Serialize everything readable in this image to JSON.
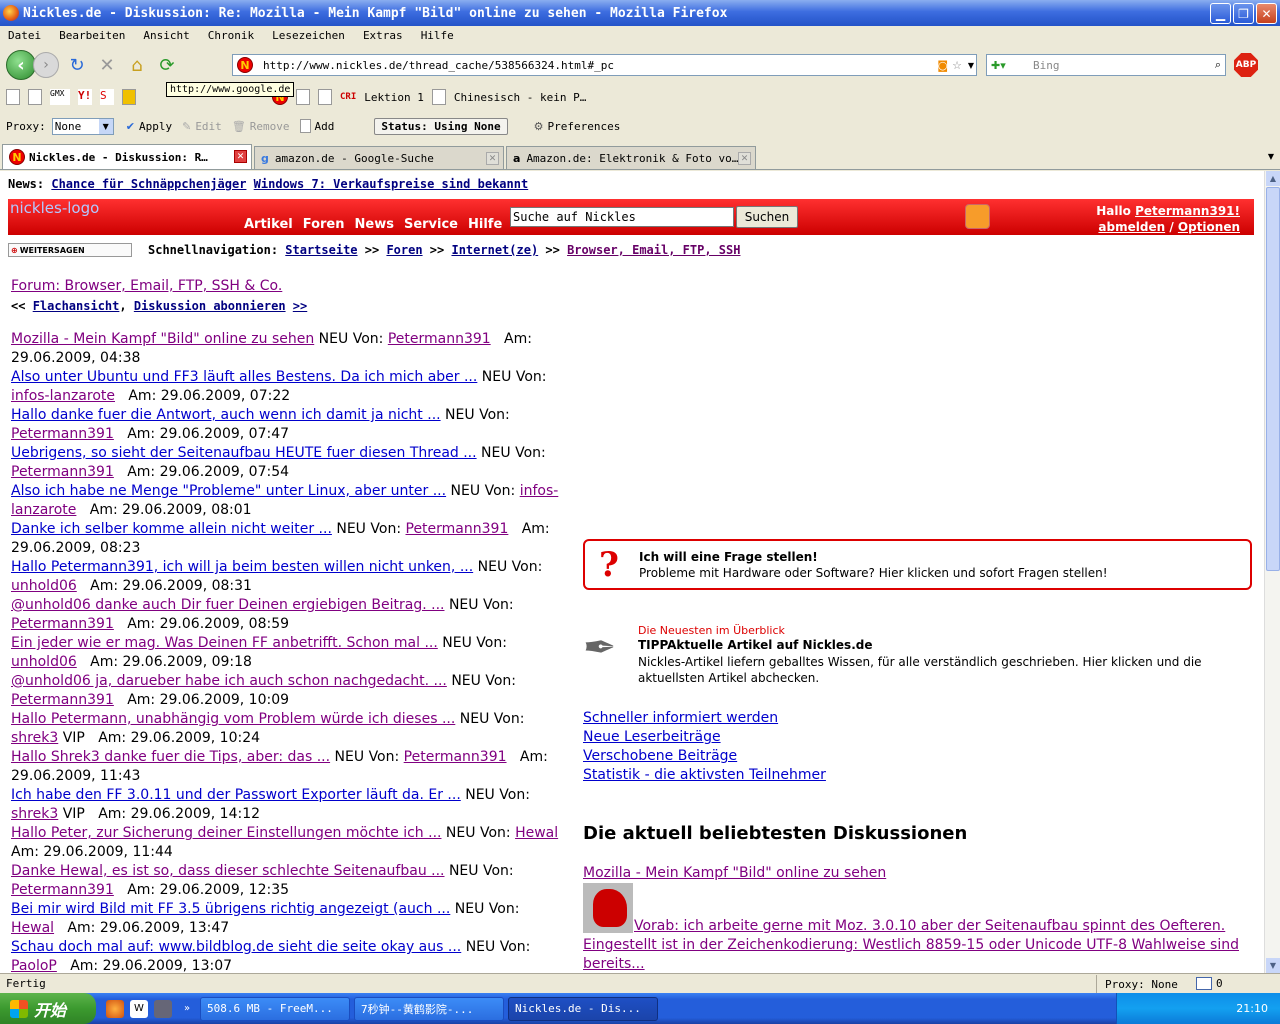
{
  "window": {
    "title": "Nickles.de - Diskussion: Re: Mozilla - Mein Kampf \"Bild\" online zu sehen - Mozilla Firefox"
  },
  "menu": [
    "Datei",
    "Bearbeiten",
    "Ansicht",
    "Chronik",
    "Lesezeichen",
    "Extras",
    "Hilfe"
  ],
  "nav": {
    "url": "http://www.nickles.de/thread_cache/538566324.html#_pc",
    "search_placeholder": "Bing",
    "abp": "ABP",
    "tooltip": "http://www.google.de"
  },
  "bookmarks": {
    "items": [
      "Lektion 1",
      "Chinesisch - kein P…"
    ]
  },
  "proxybar": {
    "label": "Proxy:",
    "value": "None",
    "apply": "Apply",
    "edit": "Edit",
    "remove": "Remove",
    "add": "Add",
    "status": "Status:  Using None",
    "preferences": "Preferences"
  },
  "tabs": [
    {
      "label": "Nickles.de - Diskussion: R…"
    },
    {
      "label": "amazon.de - Google-Suche"
    },
    {
      "label": "Amazon.de: Elektronik & Foto vo…"
    }
  ],
  "page": {
    "news_label": "News:",
    "news_links": [
      "Chance für Schnäppchenjäger",
      "Windows 7: Verkaufspreise sind bekannt"
    ],
    "logo_alt": "nickles-logo",
    "topnav": [
      "Artikel",
      "Foren",
      "News",
      "Service",
      "Hilfe"
    ],
    "search_value": "Suche auf Nickles",
    "search_button": "Suchen",
    "greeting": "Hallo",
    "username": "Petermann391!",
    "logout": "abmelden",
    "options": "Optionen",
    "share": "WEITERSAGEN",
    "quicknav_label": "Schnellnavigation:",
    "crumbs": [
      "Startseite",
      "Foren",
      "Internet(ze)",
      "Browser, Email, FTP, SSH"
    ],
    "forum_title": "Forum: Browser, Email, FTP, SSH & Co.",
    "flat": "Flachansicht",
    "subscribe": "Diskussion abonnieren",
    "thread": [
      {
        "title": "Mozilla - Mein Kampf \"Bild\" online zu sehen",
        "author": "Petermann391",
        "date": "29.06.2009, 04:38",
        "visited": true
      },
      {
        "title": "Also unter Ubuntu und FF3 läuft alles Bestens. Da ich mich aber ...",
        "author": "infos-lanzarote",
        "date": "29.06.2009, 07:22",
        "visited": false
      },
      {
        "title": "Hallo danke fuer die Antwort, auch wenn ich damit ja nicht ...",
        "author": "Petermann391",
        "date": "29.06.2009, 07:47",
        "visited": false
      },
      {
        "title": "Uebrigens, so sieht der Seitenaufbau HEUTE fuer diesen Thread ...",
        "author": "Petermann391",
        "date": "29.06.2009, 07:54",
        "visited": false
      },
      {
        "title": "Also ich habe ne Menge \"Probleme\" unter Linux, aber unter ...",
        "author": "infos-lanzarote",
        "date": "29.06.2009, 08:01",
        "visited": false
      },
      {
        "title": "Danke ich selber komme allein nicht weiter ...",
        "author": "Petermann391",
        "date": "29.06.2009, 08:23",
        "visited": false
      },
      {
        "title": "Hallo Petermann391, ich will ja beim besten willen nicht unken, ...",
        "author": "unhold06",
        "date": "29.06.2009, 08:31",
        "visited": false
      },
      {
        "title": "@unhold06 danke auch Dir fuer Deinen ergiebigen Beitrag. ...",
        "author": "Petermann391",
        "date": "29.06.2009, 08:59",
        "visited": true
      },
      {
        "title": "Ein jeder wie er mag. Was Deinen FF anbetrifft. Schon mal ...",
        "author": "unhold06",
        "date": "29.06.2009, 09:18",
        "visited": true
      },
      {
        "title": "@unhold06 ja, darueber habe ich auch schon nachgedacht. ...",
        "author": "Petermann391",
        "date": "29.06.2009, 10:09",
        "visited": true
      },
      {
        "title": "Hallo Petermann, unabhängig vom Problem würde ich dieses ...",
        "author": "shrek3",
        "vip": "VIP",
        "date": "29.06.2009, 10:24",
        "visited": true
      },
      {
        "title": "Hallo Shrek3 danke fuer die Tips, aber: das ...",
        "author": "Petermann391",
        "date": "29.06.2009, 11:43",
        "visited": true
      },
      {
        "title": "Ich habe den FF 3.0.11 und der Passwort Exporter läuft da. Er ...",
        "author": "shrek3",
        "vip": "VIP",
        "date": "29.06.2009, 14:12",
        "visited": false
      },
      {
        "title": "Hallo Peter, zur Sicherung deiner Einstellungen möchte ich ...",
        "author": "Hewal",
        "date": "29.06.2009, 11:44",
        "visited": true
      },
      {
        "title": "Danke Hewal, es ist so, dass dieser schlechte Seitenaufbau ...",
        "author": "Petermann391",
        "date": "29.06.2009, 12:35",
        "visited": true
      },
      {
        "title": "Bei mir wird Bild mit FF 3.5 übrigens richtig angezeigt (auch ...",
        "author": "Hewal",
        "date": "29.06.2009, 13:47",
        "visited": false
      },
      {
        "title": "Schau doch mal auf: www.bildblog.de sieht die seite okay aus ...",
        "author": "PaoloP",
        "date": "29.06.2009, 13:07",
        "visited": false
      }
    ],
    "neu": "NEU",
    "von": "Von:",
    "am": "Am:",
    "ask": {
      "q": "?",
      "title": "Ich will eine Frage stellen!",
      "text": "Probleme mit Hardware oder Software? Hier klicken und sofort Fragen stellen!"
    },
    "newest": {
      "red": "Die Neuesten im Überblick",
      "title": "TIPPAktuelle Artikel auf Nickles.de",
      "text": "Nickles-Artikel liefern geballtes Wissen, für alle verständlich geschrieben. Hier klicken und die aktuellsten Artikel abchecken."
    },
    "right_links": [
      "Schneller informiert werden",
      "Neue Leserbeiträge",
      "Verschobene Beiträge",
      "Statistik - die aktivsten Teilnehmer"
    ],
    "popular_heading": "Die aktuell beliebtesten Diskussionen",
    "popular_link": "Mozilla - Mein Kampf \"Bild\" online zu sehen",
    "popular_desc": "Vorab: ich arbeite gerne mit Moz. 3.0.10 aber der Seitenaufbau spinnt des Oefteren. Eingestellt ist in der Zeichenkodierung: Westlich 8859-15 oder Unicode UTF-8 Wahlweise sind bereits..."
  },
  "status": {
    "text": "Fertig",
    "proxy": "Proxy: None",
    "count": "0"
  },
  "taskbar": {
    "start": "开始",
    "buttons": [
      "508.6 MB - FreeM...",
      "7秒钟--黄鹤影院-...",
      "Nickles.de - Dis..."
    ],
    "clock": "21:10"
  }
}
